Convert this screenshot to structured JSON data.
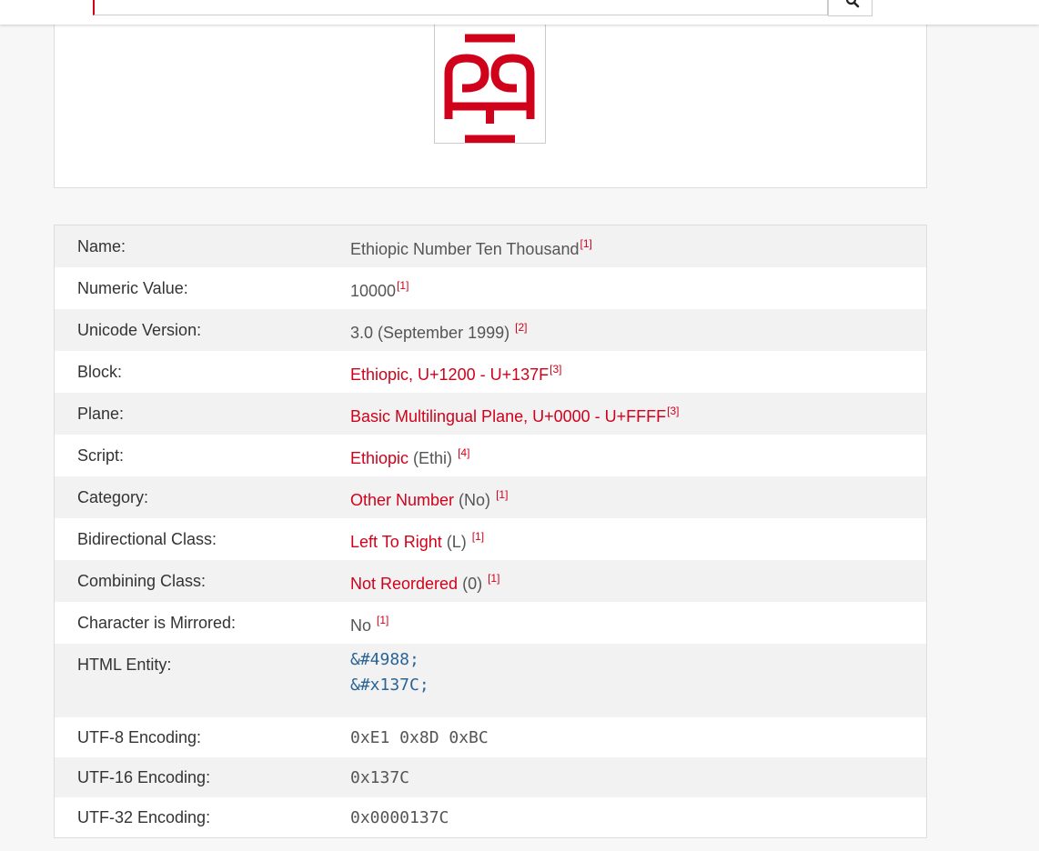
{
  "header": {
    "search_icon": "search-icon"
  },
  "glyph": {
    "character": "፼",
    "color": "#d0021b"
  },
  "properties": {
    "name": {
      "label": "Name:",
      "value": "Ethiopic Number Ten Thousand",
      "ref": "[1]"
    },
    "numeric": {
      "label": "Numeric Value:",
      "value": "10000",
      "ref": "[1]"
    },
    "version": {
      "label": "Unicode Version:",
      "value": "3.0 (September 1999)",
      "ref": "[2]"
    },
    "block": {
      "label": "Block:",
      "value": "Ethiopic, U+1200 - U+137F",
      "ref": "[3]"
    },
    "plane": {
      "label": "Plane:",
      "value": "Basic Multilingual Plane, U+0000 - U+FFFF",
      "ref": "[3]"
    },
    "script": {
      "label": "Script:",
      "link": "Ethiopic",
      "suffix": " (Ethi)",
      "ref": "[4]"
    },
    "category": {
      "label": "Category:",
      "link": "Other Number",
      "suffix": " (No)",
      "ref": "[1]"
    },
    "bidi": {
      "label": "Bidirectional Class:",
      "link": "Left To Right",
      "suffix": " (L)",
      "ref": "[1]"
    },
    "combining": {
      "label": "Combining Class:",
      "link": "Not Reordered",
      "suffix": " (0)",
      "ref": "[1]"
    },
    "mirrored": {
      "label": "Character is Mirrored:",
      "value": "No",
      "ref": "[1]"
    },
    "html_entity": {
      "label": "HTML Entity:",
      "decimal": "&#4988;",
      "hex": "&#x137C;"
    },
    "utf8": {
      "label": "UTF-8 Encoding:",
      "value": "0xE1 0x8D 0xBC"
    },
    "utf16": {
      "label": "UTF-16 Encoding:",
      "value": "0x137C"
    },
    "utf32": {
      "label": "UTF-32 Encoding:",
      "value": "0x0000137C"
    }
  }
}
